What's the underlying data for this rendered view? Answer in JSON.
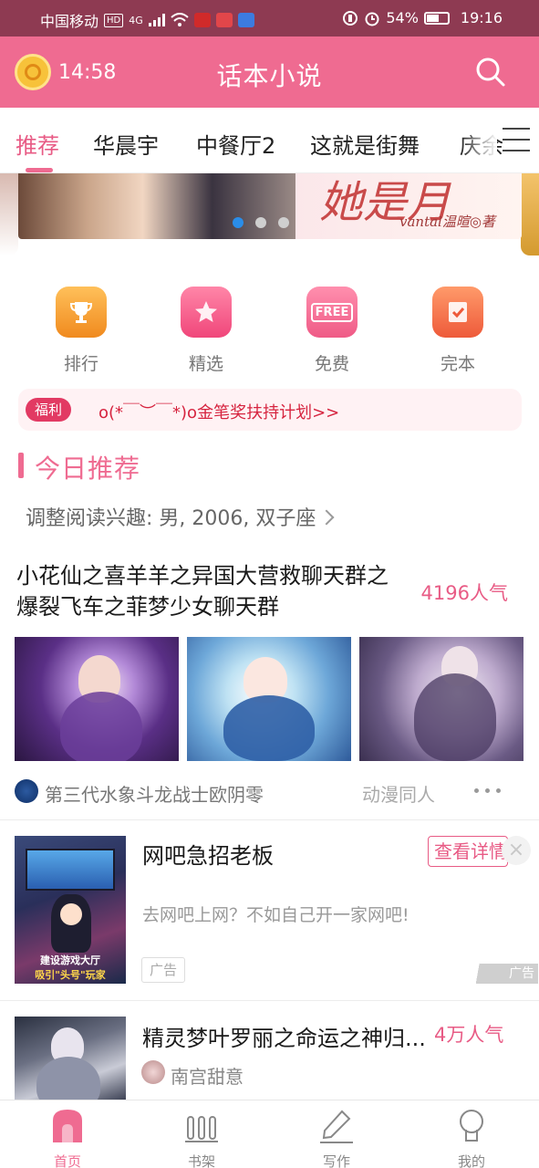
{
  "status_bar": {
    "carrier": "中国移动",
    "hd_badge": "HD",
    "network": "4G",
    "battery_percent": "54%",
    "time": "19:16"
  },
  "app_bar": {
    "timer": "14:58",
    "title": "话本小说",
    "clock_icon": "gold-coin-clock-icon",
    "search_icon": "search-icon"
  },
  "tabs": [
    {
      "label": "推荐",
      "active": true
    },
    {
      "label": "华晨宇",
      "active": false
    },
    {
      "label": "中餐厅2",
      "active": false
    },
    {
      "label": "这就是街舞",
      "active": false
    },
    {
      "label": "庆余",
      "active": false
    }
  ],
  "banner": {
    "script_text": "她是月",
    "author_text": "vantal温暄◎著",
    "dots": 3,
    "active_dot": 0
  },
  "quick_entries": [
    {
      "label": "排行",
      "icon": "trophy-icon",
      "color": "#f7a236"
    },
    {
      "label": "精选",
      "icon": "star-icon",
      "color": "#f25b84"
    },
    {
      "label": "免费",
      "icon": "free-tag-icon",
      "color": "#f56b8f",
      "icon_text": "FREE"
    },
    {
      "label": "完本",
      "icon": "check-book-icon",
      "color": "#f06a4a"
    }
  ],
  "welfare": {
    "tag": "福利",
    "text": "o(*￣︶￣*)o金笔奖扶持计划>>"
  },
  "section": {
    "title": "今日推荐",
    "interest": "调整阅读兴趣: 男, 2006, 双子座"
  },
  "card1": {
    "title": "小花仙之喜羊羊之异国大营救聊天群之爆裂飞车之菲梦少女聊天群",
    "popularity": "4196人气",
    "author": "第三代水象斗龙战士欧阴零",
    "genre": "动漫同人"
  },
  "ad_card": {
    "title": "网吧急招老板",
    "button": "查看详情",
    "description": "去网吧上网？不如自己开一家网吧!",
    "ad_label": "广告",
    "corner_label": "广告",
    "cover_caption_1": "建设游戏大厅",
    "cover_caption_2": "吸引\"头号\"玩家"
  },
  "card3": {
    "title": "精灵梦叶罗丽之命运之神归...",
    "popularity": "4万人气",
    "author": "南宫甜意"
  },
  "bottom_nav": [
    {
      "label": "首页",
      "icon": "home-icon",
      "active": true
    },
    {
      "label": "书架",
      "icon": "bookshelf-icon",
      "active": false
    },
    {
      "label": "写作",
      "icon": "pen-icon",
      "active": false
    },
    {
      "label": "我的",
      "icon": "profile-icon",
      "active": false
    }
  ],
  "colors": {
    "brand_pink": "#ef6b91",
    "status_bar": "#8e3a52",
    "accent_red": "#e23a63"
  }
}
